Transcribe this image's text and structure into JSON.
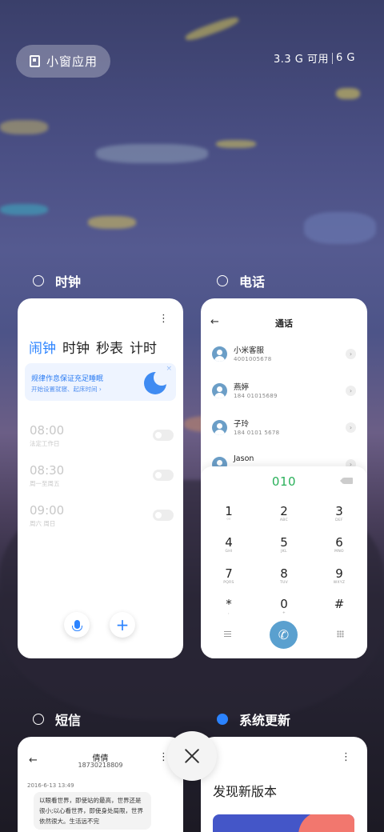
{
  "topbar": {
    "small_window_label": "小窗应用",
    "memory_available": "3.3 G 可用",
    "memory_total": "6 G"
  },
  "clock": {
    "app_name": "时钟",
    "menu_glyph": "⋮",
    "tabs": [
      "闹钟",
      "时钟",
      "秒表",
      "计时"
    ],
    "active_tab_index": 0,
    "banner_title": "规律作息保证充足睡眠",
    "banner_sub": "开始设置就寝、起床时间 ›",
    "banner_close": "×",
    "alarms": [
      {
        "time": "08:00",
        "repeat": "法定工作日",
        "enabled": false
      },
      {
        "time": "08:30",
        "repeat": "周一至周五",
        "enabled": false
      },
      {
        "time": "09:00",
        "repeat": "周六 周日",
        "enabled": false
      }
    ],
    "plus_glyph": "+"
  },
  "phone": {
    "app_name": "电话",
    "back_glyph": "←",
    "title": "通话",
    "contacts": [
      {
        "name": "小米客服",
        "number": "4001005678"
      },
      {
        "name": "燕婷",
        "number": "184 01015689"
      },
      {
        "name": "子玲",
        "number": "184 0101 5678"
      },
      {
        "name": "Jason",
        "number": ""
      }
    ],
    "chevron_glyph": "›",
    "dial_input": "010",
    "keys": [
      {
        "digit": "1",
        "letters": "ᴼᴼ"
      },
      {
        "digit": "2",
        "letters": "ABC"
      },
      {
        "digit": "3",
        "letters": "DEF"
      },
      {
        "digit": "4",
        "letters": "GHI"
      },
      {
        "digit": "5",
        "letters": "JKL"
      },
      {
        "digit": "6",
        "letters": "MNO"
      },
      {
        "digit": "7",
        "letters": "PQRS"
      },
      {
        "digit": "8",
        "letters": "TUV"
      },
      {
        "digit": "9",
        "letters": "WXYZ"
      },
      {
        "digit": "*",
        "letters": ","
      },
      {
        "digit": "0",
        "letters": "+"
      },
      {
        "digit": "#",
        "letters": ""
      }
    ],
    "call_glyph": "✆"
  },
  "sms": {
    "app_name": "短信",
    "back_glyph": "←",
    "contact_name": "倩倩",
    "contact_number": "18730218809",
    "menu_glyph": "⋮",
    "date": "2016-6-13 13:49",
    "message": "以眼看世界，即使站的最高，世界还是很小;以心看世界，即使身处局限，世界依然很大。生活远不完"
  },
  "update": {
    "app_name": "系统更新",
    "menu_glyph": "⋮",
    "headline": "发现新版本"
  }
}
